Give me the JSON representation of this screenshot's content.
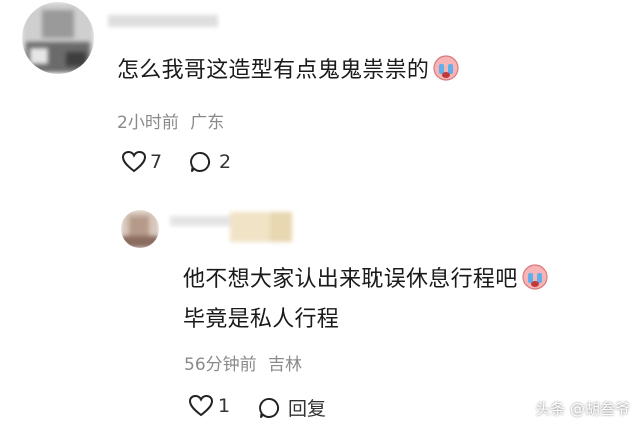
{
  "comment1": {
    "text": "怎么我哥这造型有点鬼鬼祟祟的",
    "time": "2小时前",
    "location": "广东",
    "likes": "7",
    "replies": "2"
  },
  "reply1": {
    "line1": "他不想大家认出来耽误休息行程吧",
    "line2": "毕竟是私人行程",
    "time": "56分钟前",
    "location": "吉林",
    "likes": "1",
    "reply_label": "回复"
  },
  "watermark": "头条 @胡叁爷"
}
